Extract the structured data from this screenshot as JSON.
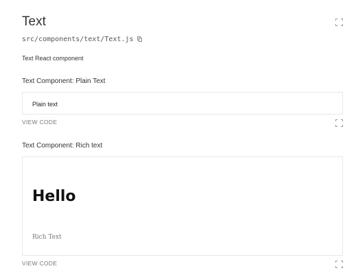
{
  "component": {
    "title": "Text",
    "path": "src/components/text/Text.js",
    "description": "Text React component"
  },
  "examples": [
    {
      "heading": "Text Component: Plain Text",
      "content": {
        "text": "Plain text"
      },
      "view_code_label": "VIEW CODE"
    },
    {
      "heading": "Text Component: Rich text",
      "content": {
        "heading": "Hello",
        "text": "Rich Text"
      },
      "view_code_label": "VIEW CODE"
    }
  ],
  "icons": {
    "open_isolated": "expand-icon",
    "copy_path": "copy-icon"
  },
  "colors": {
    "text": "#333333",
    "muted": "#777777",
    "border": "#e8e8e8"
  }
}
